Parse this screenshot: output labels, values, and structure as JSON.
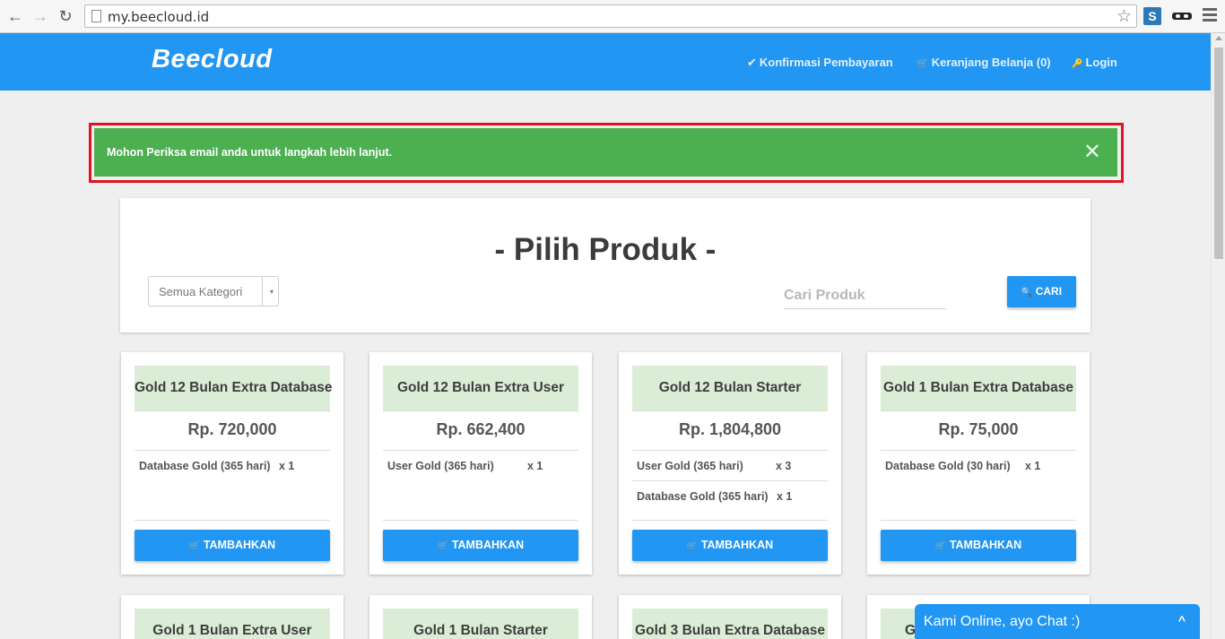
{
  "browser": {
    "url": "my.beecloud.id",
    "back_icon": "←",
    "forward_icon": "→",
    "reload_icon": "↻",
    "star_icon": "☆",
    "ext_s_label": "S"
  },
  "navbar": {
    "brand": "Beecloud",
    "confirm_icon": "✔",
    "confirm_label": "Konfirmasi Pembayaran",
    "cart_icon": "🛒",
    "cart_label": "Keranjang Belanja (0)",
    "login_icon": "🔑",
    "login_label": "Login"
  },
  "alert": {
    "message": "Mohon Periksa email anda untuk langkah lebih lanjut.",
    "close": "✕"
  },
  "product_panel": {
    "title": "- Pilih Produk -",
    "category_value": "Semua Kategori",
    "category_caret": "▾",
    "search_placeholder": "Cari Produk",
    "search_button": "CARI",
    "search_icon": "🔍"
  },
  "cards": [
    {
      "name": "Gold 12 Bulan Extra Database",
      "price": "Rp. 720,000",
      "features": [
        {
          "label": "Database Gold (365 hari)",
          "qty": "x 1"
        }
      ],
      "button": "TAMBAHKAN"
    },
    {
      "name": "Gold 12 Bulan Extra User",
      "price": "Rp. 662,400",
      "features": [
        {
          "label": "User Gold (365 hari)",
          "qty": "x 1"
        }
      ],
      "button": "TAMBAHKAN"
    },
    {
      "name": "Gold 12 Bulan Starter",
      "price": "Rp. 1,804,800",
      "features": [
        {
          "label": "User Gold (365 hari)",
          "qty": "x 3"
        },
        {
          "label": "Database Gold (365 hari)",
          "qty": "x 1"
        }
      ],
      "button": "TAMBAHKAN"
    },
    {
      "name": "Gold 1 Bulan Extra Database",
      "price": "Rp. 75,000",
      "features": [
        {
          "label": "Database Gold (30 hari)",
          "qty": "x 1"
        }
      ],
      "button": "TAMBAHKAN"
    }
  ],
  "cards_row2": [
    {
      "name": "Gold 1 Bulan Extra User"
    },
    {
      "name": "Gold 1 Bulan Starter"
    },
    {
      "name": "Gold 3 Bulan Extra Database"
    },
    {
      "name": "G"
    }
  ],
  "cart_button_icon": "🛒",
  "chat": {
    "label": "Kami Online, ayo Chat :)",
    "chevron": "^"
  },
  "colors": {
    "primary": "#2196f3",
    "success": "#4caf50",
    "alert_frame": "#e0141e",
    "card_header": "#dcedd7"
  }
}
